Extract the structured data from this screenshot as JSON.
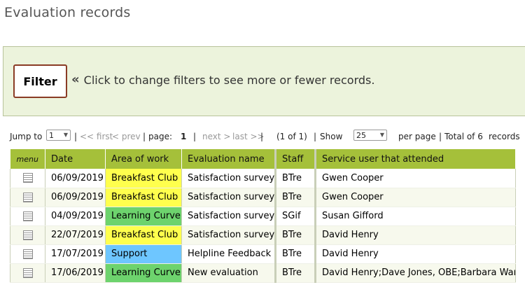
{
  "page": {
    "title": "Evaluation records"
  },
  "filter": {
    "button_label": "Filter",
    "hint_chevron": "«",
    "hint_text": "Click to change filters to see more or fewer records."
  },
  "pager": {
    "jump_to_label": "Jump to",
    "jump_to_value": "1",
    "sep1": "|",
    "first": "<< first",
    "prev": "< prev",
    "sep2": "|",
    "page_label": "page:",
    "page_value": "1",
    "sep3": "|",
    "next": "next >",
    "last": "last >>",
    "sep4": "|",
    "page_of": "(1 of 1)",
    "sep5": "|",
    "show_label": "Show",
    "show_value": "25",
    "per_page": "per page",
    "sep6": "|",
    "total_label": "Total of 6",
    "records_label": "records"
  },
  "table": {
    "headers": {
      "menu": "menu",
      "date": "Date",
      "area": "Area of work",
      "evaluation": "Evaluation name",
      "staff": "Staff",
      "service_user": "Service user that attended"
    },
    "area_colors": {
      "Breakfast Club": "#ffff4d",
      "Learning Curve": "#6dd36d",
      "Support": "#6ec6ff"
    },
    "header_color": "#a5c03a",
    "rows": [
      {
        "date": "06/09/2019",
        "area": "Breakfast Club",
        "evaluation": "Satisfaction survey",
        "staff": "BTre",
        "service_user": "Gwen Cooper"
      },
      {
        "date": "06/09/2019",
        "area": "Breakfast Club",
        "evaluation": "Satisfaction survey",
        "staff": "BTre",
        "service_user": "Gwen Cooper"
      },
      {
        "date": "04/09/2019",
        "area": "Learning Curve",
        "evaluation": "Satisfaction survey",
        "staff": "SGif",
        "service_user": "Susan Gifford"
      },
      {
        "date": "22/07/2019",
        "area": "Breakfast Club",
        "evaluation": "Satisfaction survey",
        "staff": "BTre",
        "service_user": "David Henry"
      },
      {
        "date": "17/07/2019",
        "area": "Support",
        "evaluation": "Helpline Feedback",
        "staff": "BTre",
        "service_user": "David Henry"
      },
      {
        "date": "17/06/2019",
        "area": "Learning Curve",
        "evaluation": "New evaluation",
        "staff": "BTre",
        "service_user": "David Henry;Dave Jones, OBE;Barbara Ward"
      }
    ]
  }
}
